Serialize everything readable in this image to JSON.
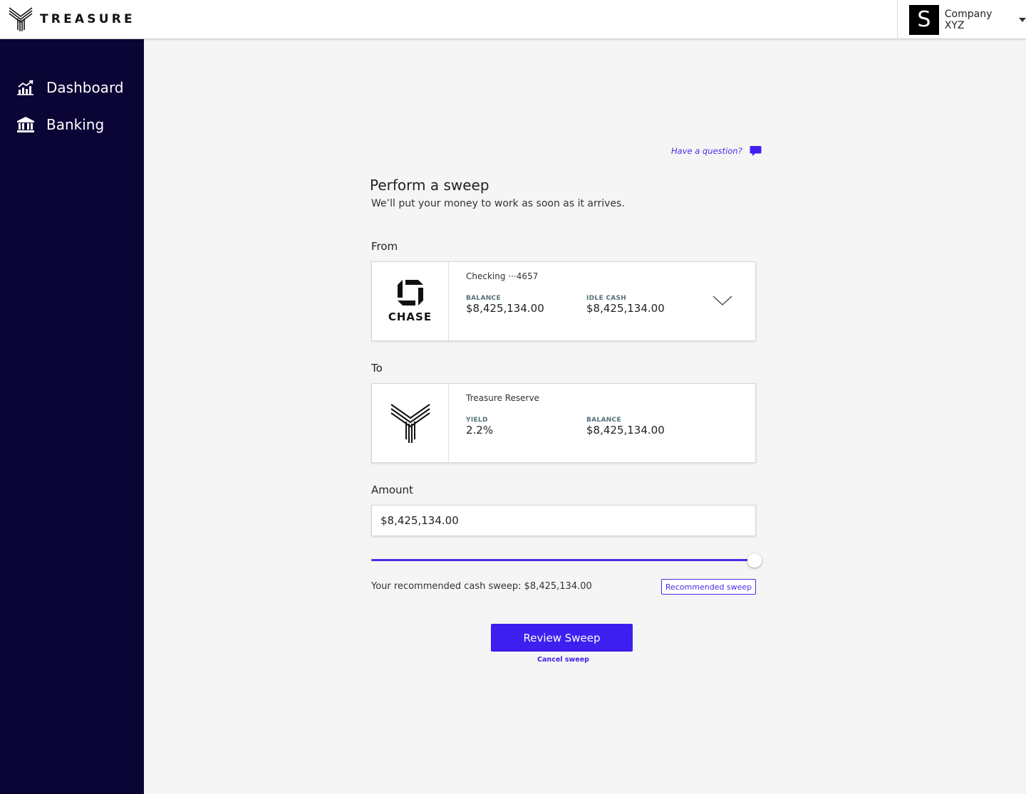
{
  "header": {
    "brand_name": "TREASURE",
    "avatar_letter": "S",
    "company_name": "Company XYZ"
  },
  "sidebar": {
    "items": [
      {
        "label": "Dashboard",
        "icon": "chart-icon"
      },
      {
        "label": "Banking",
        "icon": "bank-icon"
      }
    ]
  },
  "main": {
    "help_text": "Have a question?",
    "title": "Perform a sweep",
    "subtitle": "We’ll put your money to work as soon as it arrives.",
    "from": {
      "label": "From",
      "bank_name": "CHASE",
      "account_name": "Checking ···4657",
      "stat_a_label": "BALANCE",
      "stat_a_value": "$8,425,134.00",
      "stat_b_label": "IDLE CASH",
      "stat_b_value": "$8,425,134.00"
    },
    "to": {
      "label": "To",
      "account_name": "Treasure Reserve",
      "stat_a_label": "YIELD",
      "stat_a_value": "2.2%",
      "stat_b_label": "BALANCE",
      "stat_b_value": "$8,425,134.00"
    },
    "amount": {
      "label": "Amount",
      "value": "$8,425,134.00",
      "slider_fraction": 1.0
    },
    "recommendation_text": "Your recommended cash sweep: $8,425,134.00",
    "recommended_button": "Recommended sweep",
    "review_button": "Review Sweep",
    "cancel_link": "Cancel sweep"
  },
  "colors": {
    "sidebar_bg": "#0b0535",
    "accent": "#3d1ff0",
    "background": "#f5f5f5"
  }
}
